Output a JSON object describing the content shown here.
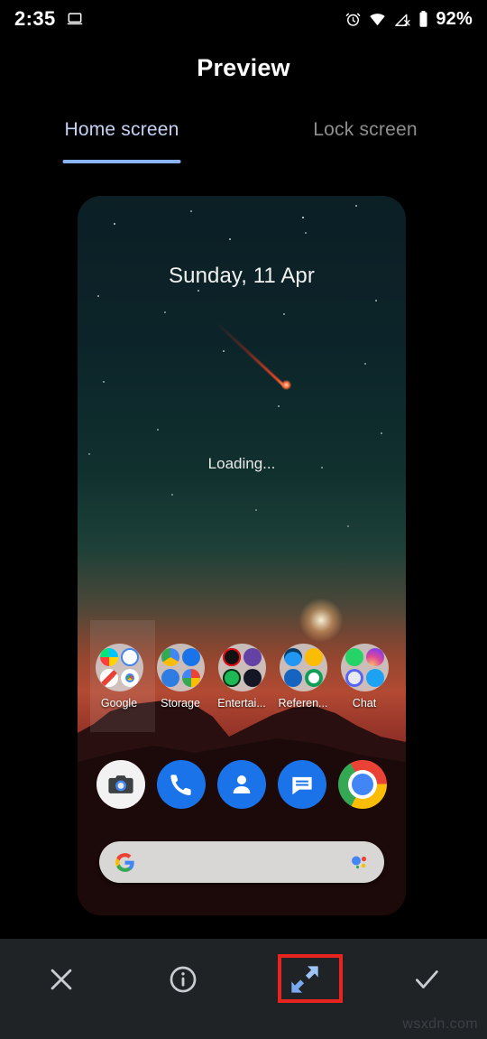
{
  "statusbar": {
    "time": "2:35",
    "cast_icon": "laptop-icon",
    "alarm_icon": "alarm-icon",
    "wifi_icon": "wifi-icon",
    "signal_icon": "signal-off-icon",
    "battery_icon": "battery-icon",
    "battery_percent": "92%"
  },
  "header": {
    "title": "Preview"
  },
  "tabs": [
    {
      "label": "Home screen",
      "active": true
    },
    {
      "label": "Lock screen",
      "active": false
    }
  ],
  "preview": {
    "date": "Sunday, 11 Apr",
    "widget_status": "Loading...",
    "folders": [
      {
        "label": "Google",
        "apps": [
          "play-store-icon",
          "google-g-icon",
          "gmail-icon",
          "chrome-icon"
        ]
      },
      {
        "label": "Storage",
        "apps": [
          "drive-icon",
          "dropbox-icon",
          "files-icon",
          "photos-icon"
        ]
      },
      {
        "label": "Entertai...",
        "apps": [
          "netflix-icon",
          "twitch-icon",
          "spotify-icon",
          "play-video-icon"
        ]
      },
      {
        "label": "Referen...",
        "apps": [
          "classroom-icon",
          "keep-icon",
          "youtube-icon",
          "sheets-icon"
        ]
      },
      {
        "label": "Chat",
        "apps": [
          "whatsapp-icon",
          "instagram-icon",
          "discord-icon",
          "twitter-icon"
        ]
      }
    ],
    "dock": [
      {
        "name": "camera-go-icon"
      },
      {
        "name": "phone-icon"
      },
      {
        "name": "contacts-icon"
      },
      {
        "name": "messages-icon"
      },
      {
        "name": "chrome-icon"
      }
    ],
    "search": {
      "logo": "google-g-icon",
      "assistant": "assistant-icon",
      "value": "",
      "placeholder": ""
    }
  },
  "toolbar": {
    "close_label": "close-icon",
    "info_label": "info-icon",
    "resize_label": "resize-icon",
    "confirm_label": "check-icon"
  },
  "watermark": "wsxdn.com",
  "colors": {
    "accent": "#8ab4f8",
    "tab_active_text": "#c5d2f5",
    "tab_inactive_text": "#8e8e8e",
    "highlight_border": "#e8241f",
    "toolbar_bg": "#202326",
    "page_bg": "#000000"
  }
}
